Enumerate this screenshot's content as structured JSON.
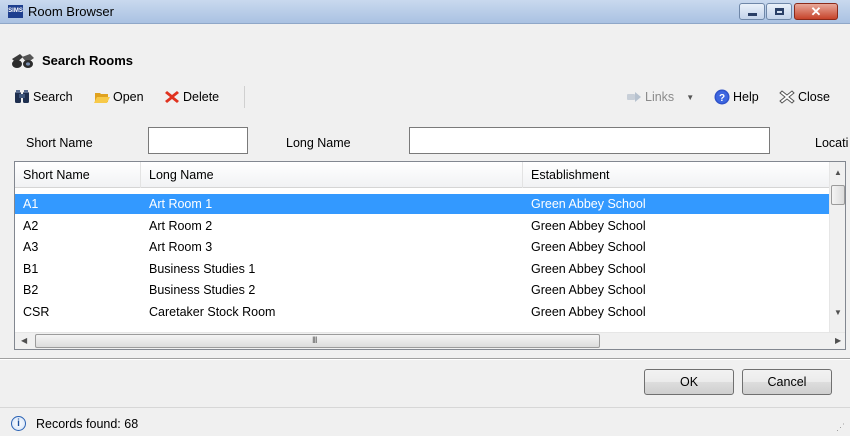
{
  "window": {
    "app_badge": "SIMS",
    "title": "Room Browser",
    "min_icon": "minimize-icon",
    "max_icon": "maximize-icon",
    "close_glyph": "✕"
  },
  "header": {
    "title": "Search Rooms",
    "icon": "binoculars-icon"
  },
  "toolbar": {
    "search": "Search",
    "open": "Open",
    "delete": "Delete",
    "links": "Links",
    "help": "Help",
    "close": "Close"
  },
  "filters": {
    "short_name_label": "Short Name",
    "short_name_value": "",
    "long_name_label": "Long Name",
    "long_name_value": "",
    "location_label": "Locati"
  },
  "grid": {
    "columns": [
      "Short Name",
      "Long Name",
      "Establishment"
    ],
    "rows": [
      {
        "short": "A1",
        "long": "Art Room 1",
        "est": "Green Abbey School",
        "selected": true
      },
      {
        "short": "A2",
        "long": "Art Room 2",
        "est": "Green Abbey School",
        "selected": false
      },
      {
        "short": "A3",
        "long": "Art Room 3",
        "est": "Green Abbey School",
        "selected": false
      },
      {
        "short": "B1",
        "long": "Business Studies 1",
        "est": "Green Abbey School",
        "selected": false
      },
      {
        "short": "B2",
        "long": "Business Studies 2",
        "est": "Green Abbey School",
        "selected": false
      },
      {
        "short": "CSR",
        "long": "Caretaker Stock Room",
        "est": "Green Abbey School",
        "selected": false
      }
    ],
    "grip": "III"
  },
  "buttons": {
    "ok": "OK",
    "cancel": "Cancel"
  },
  "status": {
    "text": "Records found: 68",
    "icon": "info-icon"
  },
  "colors": {
    "selection": "#3399ff",
    "titlebar": "#b9cde8",
    "close_red": "#c6432a"
  }
}
